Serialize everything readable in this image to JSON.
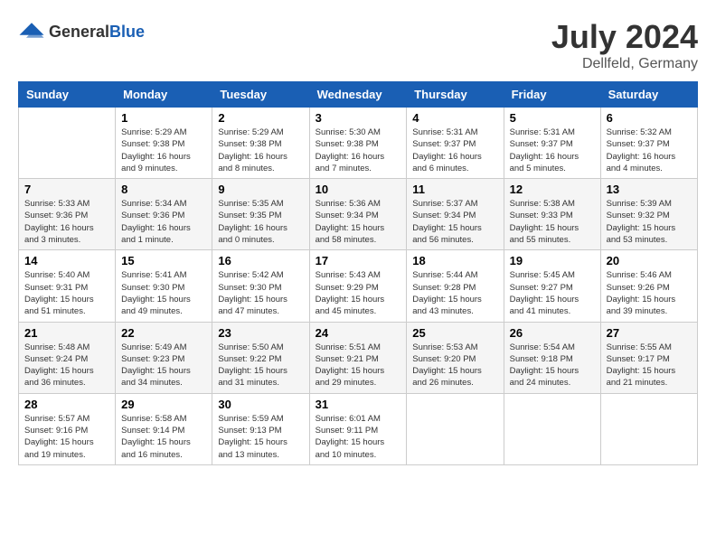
{
  "header": {
    "logo_general": "General",
    "logo_blue": "Blue",
    "title": "July 2024",
    "location": "Dellfeld, Germany"
  },
  "columns": [
    "Sunday",
    "Monday",
    "Tuesday",
    "Wednesday",
    "Thursday",
    "Friday",
    "Saturday"
  ],
  "weeks": [
    [
      {
        "day": "",
        "sunrise": "",
        "sunset": "",
        "daylight": ""
      },
      {
        "day": "1",
        "sunrise": "Sunrise: 5:29 AM",
        "sunset": "Sunset: 9:38 PM",
        "daylight": "Daylight: 16 hours and 9 minutes."
      },
      {
        "day": "2",
        "sunrise": "Sunrise: 5:29 AM",
        "sunset": "Sunset: 9:38 PM",
        "daylight": "Daylight: 16 hours and 8 minutes."
      },
      {
        "day": "3",
        "sunrise": "Sunrise: 5:30 AM",
        "sunset": "Sunset: 9:38 PM",
        "daylight": "Daylight: 16 hours and 7 minutes."
      },
      {
        "day": "4",
        "sunrise": "Sunrise: 5:31 AM",
        "sunset": "Sunset: 9:37 PM",
        "daylight": "Daylight: 16 hours and 6 minutes."
      },
      {
        "day": "5",
        "sunrise": "Sunrise: 5:31 AM",
        "sunset": "Sunset: 9:37 PM",
        "daylight": "Daylight: 16 hours and 5 minutes."
      },
      {
        "day": "6",
        "sunrise": "Sunrise: 5:32 AM",
        "sunset": "Sunset: 9:37 PM",
        "daylight": "Daylight: 16 hours and 4 minutes."
      }
    ],
    [
      {
        "day": "7",
        "sunrise": "Sunrise: 5:33 AM",
        "sunset": "Sunset: 9:36 PM",
        "daylight": "Daylight: 16 hours and 3 minutes."
      },
      {
        "day": "8",
        "sunrise": "Sunrise: 5:34 AM",
        "sunset": "Sunset: 9:36 PM",
        "daylight": "Daylight: 16 hours and 1 minute."
      },
      {
        "day": "9",
        "sunrise": "Sunrise: 5:35 AM",
        "sunset": "Sunset: 9:35 PM",
        "daylight": "Daylight: 16 hours and 0 minutes."
      },
      {
        "day": "10",
        "sunrise": "Sunrise: 5:36 AM",
        "sunset": "Sunset: 9:34 PM",
        "daylight": "Daylight: 15 hours and 58 minutes."
      },
      {
        "day": "11",
        "sunrise": "Sunrise: 5:37 AM",
        "sunset": "Sunset: 9:34 PM",
        "daylight": "Daylight: 15 hours and 56 minutes."
      },
      {
        "day": "12",
        "sunrise": "Sunrise: 5:38 AM",
        "sunset": "Sunset: 9:33 PM",
        "daylight": "Daylight: 15 hours and 55 minutes."
      },
      {
        "day": "13",
        "sunrise": "Sunrise: 5:39 AM",
        "sunset": "Sunset: 9:32 PM",
        "daylight": "Daylight: 15 hours and 53 minutes."
      }
    ],
    [
      {
        "day": "14",
        "sunrise": "Sunrise: 5:40 AM",
        "sunset": "Sunset: 9:31 PM",
        "daylight": "Daylight: 15 hours and 51 minutes."
      },
      {
        "day": "15",
        "sunrise": "Sunrise: 5:41 AM",
        "sunset": "Sunset: 9:30 PM",
        "daylight": "Daylight: 15 hours and 49 minutes."
      },
      {
        "day": "16",
        "sunrise": "Sunrise: 5:42 AM",
        "sunset": "Sunset: 9:30 PM",
        "daylight": "Daylight: 15 hours and 47 minutes."
      },
      {
        "day": "17",
        "sunrise": "Sunrise: 5:43 AM",
        "sunset": "Sunset: 9:29 PM",
        "daylight": "Daylight: 15 hours and 45 minutes."
      },
      {
        "day": "18",
        "sunrise": "Sunrise: 5:44 AM",
        "sunset": "Sunset: 9:28 PM",
        "daylight": "Daylight: 15 hours and 43 minutes."
      },
      {
        "day": "19",
        "sunrise": "Sunrise: 5:45 AM",
        "sunset": "Sunset: 9:27 PM",
        "daylight": "Daylight: 15 hours and 41 minutes."
      },
      {
        "day": "20",
        "sunrise": "Sunrise: 5:46 AM",
        "sunset": "Sunset: 9:26 PM",
        "daylight": "Daylight: 15 hours and 39 minutes."
      }
    ],
    [
      {
        "day": "21",
        "sunrise": "Sunrise: 5:48 AM",
        "sunset": "Sunset: 9:24 PM",
        "daylight": "Daylight: 15 hours and 36 minutes."
      },
      {
        "day": "22",
        "sunrise": "Sunrise: 5:49 AM",
        "sunset": "Sunset: 9:23 PM",
        "daylight": "Daylight: 15 hours and 34 minutes."
      },
      {
        "day": "23",
        "sunrise": "Sunrise: 5:50 AM",
        "sunset": "Sunset: 9:22 PM",
        "daylight": "Daylight: 15 hours and 31 minutes."
      },
      {
        "day": "24",
        "sunrise": "Sunrise: 5:51 AM",
        "sunset": "Sunset: 9:21 PM",
        "daylight": "Daylight: 15 hours and 29 minutes."
      },
      {
        "day": "25",
        "sunrise": "Sunrise: 5:53 AM",
        "sunset": "Sunset: 9:20 PM",
        "daylight": "Daylight: 15 hours and 26 minutes."
      },
      {
        "day": "26",
        "sunrise": "Sunrise: 5:54 AM",
        "sunset": "Sunset: 9:18 PM",
        "daylight": "Daylight: 15 hours and 24 minutes."
      },
      {
        "day": "27",
        "sunrise": "Sunrise: 5:55 AM",
        "sunset": "Sunset: 9:17 PM",
        "daylight": "Daylight: 15 hours and 21 minutes."
      }
    ],
    [
      {
        "day": "28",
        "sunrise": "Sunrise: 5:57 AM",
        "sunset": "Sunset: 9:16 PM",
        "daylight": "Daylight: 15 hours and 19 minutes."
      },
      {
        "day": "29",
        "sunrise": "Sunrise: 5:58 AM",
        "sunset": "Sunset: 9:14 PM",
        "daylight": "Daylight: 15 hours and 16 minutes."
      },
      {
        "day": "30",
        "sunrise": "Sunrise: 5:59 AM",
        "sunset": "Sunset: 9:13 PM",
        "daylight": "Daylight: 15 hours and 13 minutes."
      },
      {
        "day": "31",
        "sunrise": "Sunrise: 6:01 AM",
        "sunset": "Sunset: 9:11 PM",
        "daylight": "Daylight: 15 hours and 10 minutes."
      },
      {
        "day": "",
        "sunrise": "",
        "sunset": "",
        "daylight": ""
      },
      {
        "day": "",
        "sunrise": "",
        "sunset": "",
        "daylight": ""
      },
      {
        "day": "",
        "sunrise": "",
        "sunset": "",
        "daylight": ""
      }
    ]
  ]
}
